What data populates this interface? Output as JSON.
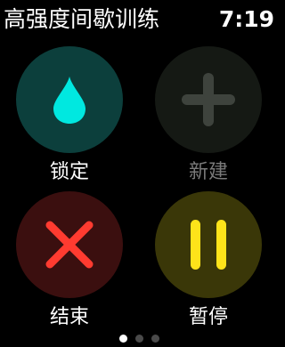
{
  "header": {
    "title": "高强度间歇训练",
    "time": "7:19"
  },
  "controls": {
    "lock": {
      "label": "锁定",
      "icon": "water-drop-icon",
      "icon_color": "#00e8e0"
    },
    "new": {
      "label": "新建",
      "icon": "plus-icon",
      "icon_color": "#3e433d",
      "disabled": true
    },
    "end": {
      "label": "结束",
      "icon": "close-x-icon",
      "icon_color": "#ff3b30"
    },
    "pause": {
      "label": "暂停",
      "icon": "pause-icon",
      "icon_color": "#fde31a"
    }
  },
  "pager": {
    "count": 3,
    "active_index": 0
  },
  "colors": {
    "background": "#000000",
    "lock_bg": "#0c3f3c",
    "new_bg": "#151914",
    "end_bg": "#3b0f0f",
    "pause_bg": "#3a3708",
    "disabled_text": "#7a7a7a"
  }
}
